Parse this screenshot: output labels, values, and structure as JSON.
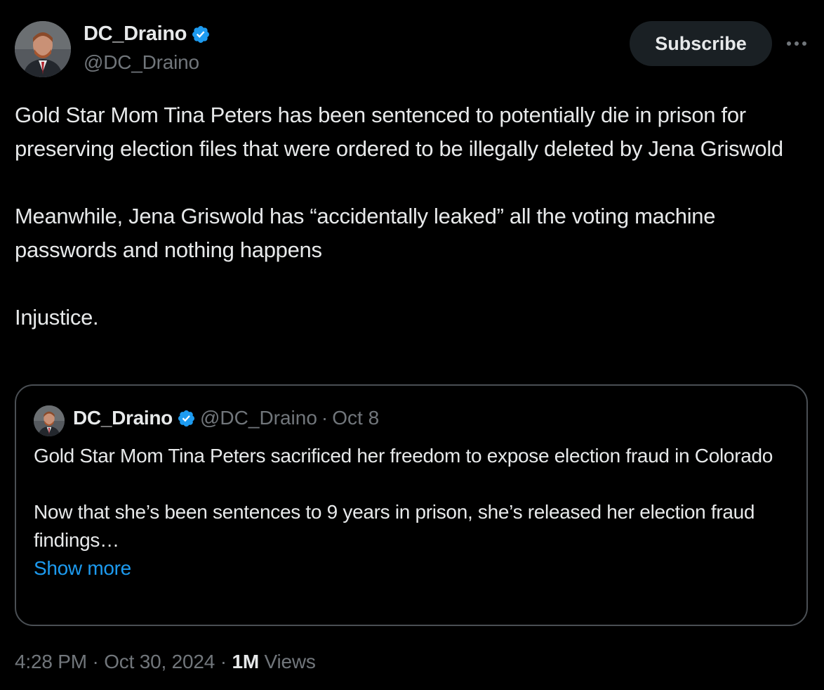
{
  "author": {
    "display_name": "DC_Draino",
    "handle": "@DC_Draino",
    "verified": true
  },
  "actions": {
    "subscribe_label": "Subscribe",
    "more_icon": "more-horizontal-icon"
  },
  "tweet": {
    "paragraphs": [
      "Gold Star Mom Tina Peters has been sentenced to potentially die in prison for preserving election files that were ordered to be illegally deleted by Jena Griswold",
      "Meanwhile, Jena Griswold has “accidentally leaked” all the voting machine passwords and nothing happens",
      "Injustice."
    ]
  },
  "quote": {
    "display_name": "DC_Draino",
    "handle": "@DC_Draino",
    "separator": "·",
    "date": "Oct 8",
    "paragraphs": [
      "Gold Star Mom Tina Peters sacrificed her freedom to expose election fraud in Colorado",
      "Now that she’s been sentences to 9 years in prison, she’s released her election fraud findings…"
    ],
    "show_more_label": "Show more"
  },
  "meta": {
    "time": "4:28 PM",
    "separator": "·",
    "date": "Oct 30, 2024",
    "views_count": "1M",
    "views_label": "Views"
  },
  "colors": {
    "background": "#000000",
    "text_primary": "#e7e9ea",
    "text_secondary": "#71767b",
    "accent": "#1d9bf0",
    "border": "#4a4f54",
    "subscribe_bg": "#1a2024"
  }
}
